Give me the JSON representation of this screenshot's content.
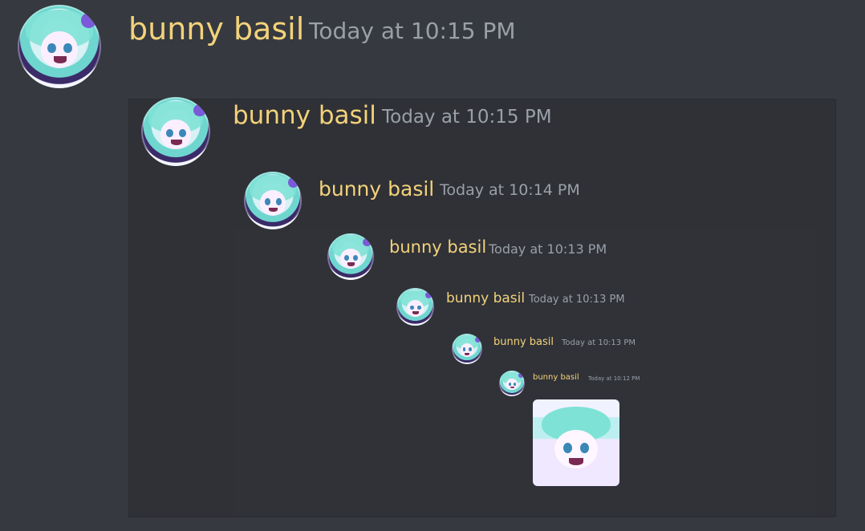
{
  "colors": {
    "background": "#36393f",
    "embed": "#2f3136",
    "username": "#f3d27a",
    "timestamp": "#9aa0a8"
  },
  "messages": [
    {
      "username": "bunny basil",
      "timestamp": "Today at 10:15 PM",
      "avatar_icon": "avatar-icon"
    },
    {
      "username": "bunny basil",
      "timestamp": "Today at 10:15 PM",
      "avatar_icon": "avatar-icon"
    },
    {
      "username": "bunny basil",
      "timestamp": "Today at 10:14 PM",
      "avatar_icon": "avatar-icon"
    },
    {
      "username": "bunny basil",
      "timestamp": "Today at 10:13 PM",
      "avatar_icon": "avatar-icon"
    },
    {
      "username": "bunny basil",
      "timestamp": "Today at 10:13 PM",
      "avatar_icon": "avatar-icon"
    },
    {
      "username": "bunny basil",
      "timestamp": "Today at 10:13 PM",
      "avatar_icon": "avatar-icon"
    },
    {
      "username": "bunny basil",
      "timestamp": "Today at 10:12 PM",
      "avatar_icon": "avatar-icon"
    }
  ],
  "attachment": {
    "icon": "image-attachment"
  }
}
